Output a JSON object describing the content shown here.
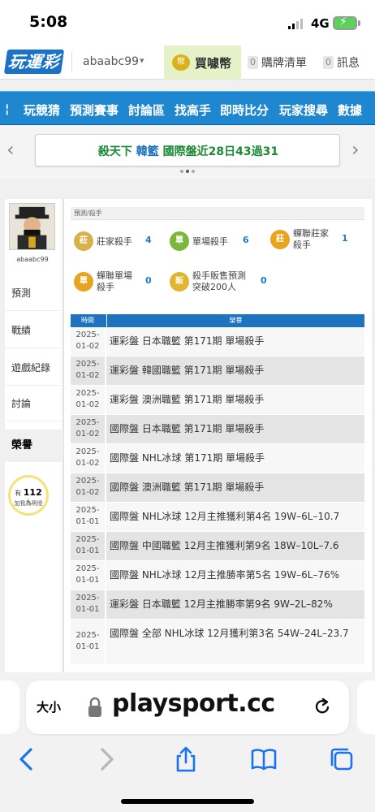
{
  "status": {
    "time": "5:08",
    "network": "4G"
  },
  "header": {
    "logo": "玩運彩",
    "username": "abaabc99",
    "coin_label": "買噱幣",
    "cart_count": "0",
    "cart_label": "購牌清單",
    "msg_count": "0",
    "msg_label": "訊息"
  },
  "nav": {
    "items": [
      "玩競猜",
      "預測賽事",
      "討論區",
      "找高手",
      "即時比分",
      "玩家搜尋",
      "數據"
    ]
  },
  "news": {
    "prefix": "殺天下",
    "team": "韓籃",
    "text": "國際盤近28日43過31"
  },
  "sidebar": {
    "avatar_name": "abaabc99",
    "items": [
      "預測",
      "戰績",
      "遊戲紀錄",
      "討論"
    ],
    "active": "榮譽",
    "bulb_pre": "有",
    "bulb_count": "112",
    "bulb_post": "人",
    "bulb_sub": "加我為明燈"
  },
  "main": {
    "crumb": "預測/殺手",
    "stats": [
      {
        "icon": "莊",
        "label": "莊家殺手",
        "value": "4"
      },
      {
        "icon": "單",
        "label": "單場殺手",
        "value": "6"
      },
      {
        "icon": "莊",
        "label": "蟬聯莊家殺手",
        "value": "1"
      },
      {
        "icon": "單",
        "label": "蟬聯單場殺手",
        "value": "0"
      },
      {
        "icon": "販",
        "label": "殺手販售預測突破200人",
        "value": "0"
      }
    ],
    "table_headers": {
      "time": "時間",
      "honor": "榮譽"
    },
    "rows": [
      {
        "date": "2025-01-02",
        "text": "運彩盤 日本職籃 第171期 單場殺手"
      },
      {
        "date": "2025-01-02",
        "text": "運彩盤 韓國職籃 第171期 單場殺手"
      },
      {
        "date": "2025-01-02",
        "text": "運彩盤 澳洲職籃 第171期 單場殺手"
      },
      {
        "date": "2025-01-02",
        "text": "國際盤 日本職籃 第171期 單場殺手"
      },
      {
        "date": "2025-01-02",
        "text": "國際盤 NHL冰球 第171期 單場殺手"
      },
      {
        "date": "2025-01-02",
        "text": "國際盤 澳洲職籃 第171期 單場殺手"
      },
      {
        "date": "2025-01-01",
        "text": "國際盤 NHL冰球 12月主推獲利第4名 19W–6L–10.7"
      },
      {
        "date": "2025-01-01",
        "text": "國際盤 中國職籃 12月主推獲利第9名 18W–10L–7.6"
      },
      {
        "date": "2025-01-01",
        "text": "國際盤 NHL冰球 12月主推勝率第5名 19W–6L–76%"
      },
      {
        "date": "2025-01-01",
        "text": "運彩盤 日本職籃 12月主推勝率第9名 9W–2L–82%"
      },
      {
        "date": "2025-01-01",
        "text": "國際盤 全部 NHL冰球 12月獲利第3名 54W–24L–23.7"
      }
    ]
  },
  "browser": {
    "text_size": "大小",
    "domain": "playsport.cc"
  },
  "colors": {
    "nav_blue": "#1f87cf",
    "news_green": "#1d8a34",
    "value_blue": "#1a7cc7",
    "ios_blue": "#1a73e8"
  }
}
